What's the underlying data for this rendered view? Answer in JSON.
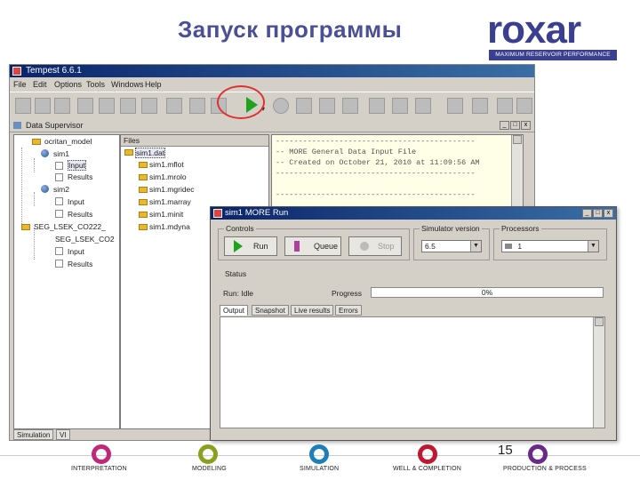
{
  "slide": {
    "title": "Запуск программы",
    "page_number": "15"
  },
  "logo": {
    "word": "roxar",
    "tagline": "MAXIMUM RESERVOIR PERFORMANCE"
  },
  "app": {
    "title": "Tempest 6.6.1",
    "menu": [
      "File",
      "Edit",
      "Options",
      "Tools",
      "Windows",
      "Help"
    ],
    "data_supervisor_title": "Data Supervisor",
    "tree": {
      "root": "ocritan_model",
      "sim1": "sim1",
      "sim1_input": "Input",
      "sim1_results": "Results",
      "sim2": "sim2",
      "sim2_input": "Input",
      "sim2_results": "Results",
      "seg": "SEG_LSEK_CO222_",
      "seg_child": "SEG_LSEK_CO2",
      "seg_input": "Input",
      "seg_results": "Results"
    },
    "files_header": "Files",
    "files": [
      "sim1.dat",
      "sim1.mflot",
      "sim1.mrolo",
      "sim1.mgridec",
      "sim1.marray",
      "sim1.minit",
      "sim1.mdyna"
    ],
    "editor_lines": [
      "--------------------------------------------",
      "-- MORE General Data Input File",
      "-- Created on October 21, 2010 at 11:09:56 AM",
      "--------------------------------------------",
      "--------------------------------------------"
    ],
    "bottom_tabs": [
      "Simulation",
      "VI"
    ]
  },
  "dialog": {
    "title": "sim1 MORE Run",
    "controls_label": "Controls",
    "run_label": "Run",
    "queue_label": "Queue",
    "stop_label": "Stop",
    "sim_version_label": "Simulator version",
    "sim_version_value": "6.5",
    "processors_label": "Processors",
    "processors_value": "1",
    "status_label": "Status",
    "run_status": "Run: Idle",
    "progress_label": "Progress",
    "progress_value": "0%",
    "tabs": [
      "Output",
      "Snapshot",
      "Live results",
      "Errors"
    ]
  },
  "footer": {
    "labels": [
      "INTERPRETATION",
      "MODELING",
      "SIMULATION",
      "WELL & COMPLETION",
      "PRODUCTION & PROCESS"
    ],
    "colors": [
      "#c0287a",
      "#8aa020",
      "#1e7eb6",
      "#c01830",
      "#6a2a8a"
    ]
  }
}
